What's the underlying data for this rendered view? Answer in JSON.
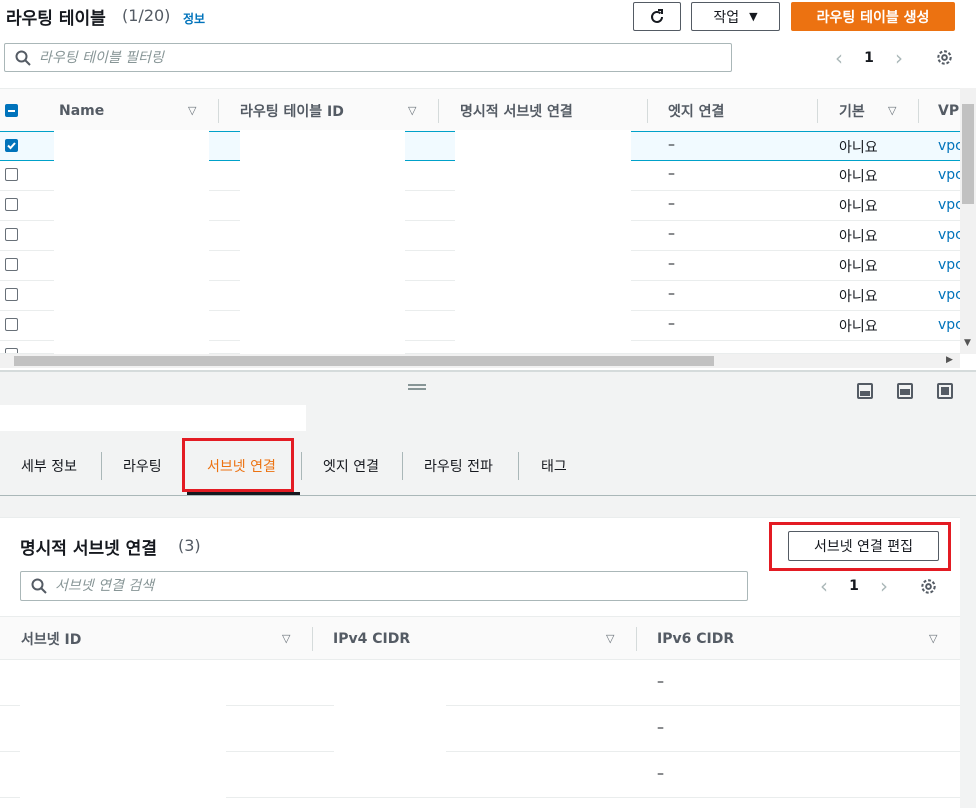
{
  "header": {
    "title": "라우팅 테이블",
    "count": "(1/20)",
    "info": "정보",
    "refresh_icon": "refresh-icon",
    "actions_label": "작업",
    "create_label": "라우팅 테이블 생성",
    "accent_color": "#ec7211"
  },
  "filter": {
    "placeholder": "라우팅 테이블 필터링"
  },
  "pagination": {
    "page": "1"
  },
  "table": {
    "columns": [
      "Name",
      "라우팅 테이블 ID",
      "명시적 서브넷 연결",
      "엣지 연결",
      "기본",
      "VP"
    ],
    "rows": [
      {
        "selected": true,
        "edge": "–",
        "main": "",
        "vpc": "vpc"
      },
      {
        "selected": false,
        "edge": "–",
        "main": "아니요",
        "vpc": "vpc"
      },
      {
        "selected": false,
        "edge": "–",
        "main": "아니요",
        "vpc": "vpc"
      },
      {
        "selected": false,
        "edge": "–",
        "main": "아니요",
        "vpc": "vpc"
      },
      {
        "selected": false,
        "edge": "–",
        "main": "아니요",
        "vpc": "vpc"
      },
      {
        "selected": false,
        "edge": "–",
        "main": "아니요",
        "vpc": "vpc"
      },
      {
        "selected": false,
        "edge": "–",
        "main": "아니요",
        "vpc": "vpc"
      }
    ],
    "first_row_main": "아니요"
  },
  "details": {
    "tabs": [
      "세부 정보",
      "라우팅",
      "서브넷 연결",
      "엣지 연결",
      "라우팅 전파",
      "태그"
    ],
    "active_tab": "서브넷 연결",
    "section_title": "명시적 서브넷 연결",
    "section_count": "(3)",
    "edit_label": "서브넷 연결 편집",
    "search_placeholder": "서브넷 연결 검색",
    "page": "1",
    "columns": [
      "서브넷 ID",
      "IPv4 CIDR",
      "IPv6 CIDR"
    ],
    "rows": [
      {
        "ipv6": "–"
      },
      {
        "ipv6": "–"
      },
      {
        "ipv6": "–"
      }
    ]
  }
}
